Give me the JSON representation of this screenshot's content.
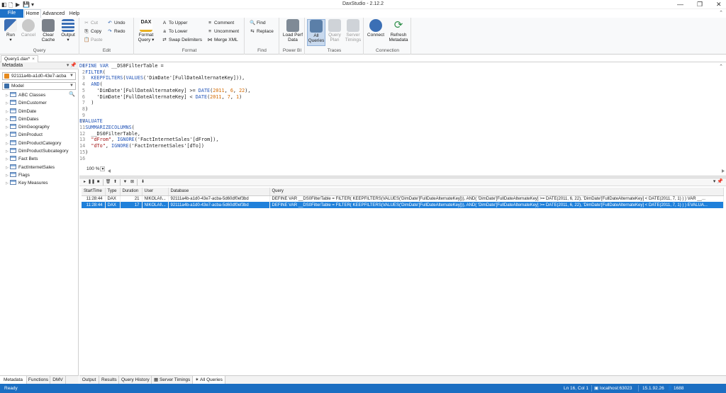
{
  "window": {
    "title": "DaxStudio - 2.12.2"
  },
  "menu": {
    "file": "File",
    "tabs": [
      "Home",
      "Advanced",
      "Help"
    ]
  },
  "ribbon": {
    "query": {
      "label": "Query",
      "run": "Run",
      "cancel": "Cancel",
      "clear_cache": "Clear Cache",
      "output": "Output"
    },
    "edit": {
      "label": "Edit",
      "cut": "Cut",
      "copy": "Copy",
      "paste": "Paste",
      "undo": "Undo",
      "redo": "Redo"
    },
    "format": {
      "label": "Format",
      "format_query": "Format Query",
      "to_upper": "To Upper",
      "to_lower": "To Lower",
      "swap_delimiters": "Swap Delimiters",
      "comment": "Comment",
      "uncomment": "Uncomment",
      "merge_xml": "Merge XML",
      "dax_logo": "DAX"
    },
    "find": {
      "label": "Find",
      "find": "Find",
      "replace": "Replace"
    },
    "powerbi": {
      "label": "Power BI",
      "load_perf_data": "Load Perf Data"
    },
    "traces": {
      "label": "Traces",
      "all_queries": "All Queries",
      "query_plan": "Query Plan",
      "server_timings": "Server Timings"
    },
    "connection": {
      "label": "Connection",
      "connect": "Connect",
      "refresh_metadata": "Refresh Metadata"
    }
  },
  "document_tab": {
    "title": "Query1.dax*",
    "close": "×"
  },
  "metadata": {
    "header": "Metadata",
    "pin": "▾ 📌",
    "database": "92111a4b-a1d0-43e7-acba",
    "model": "Model",
    "tables": [
      "ABC Classes",
      "DimCustomer",
      "DimDate",
      "DimDates",
      "DimGeography",
      "DimProduct",
      "DimProductCategory",
      "DimProductSubcategory",
      "Fact Bets",
      "FactInternetSales",
      "Flags",
      "Key Measures"
    ],
    "tabs": [
      "Metadata",
      "Functions",
      "DMV"
    ]
  },
  "editor": {
    "line_numbers": [
      "1",
      "2",
      "3",
      "4",
      "5",
      "6",
      "7",
      "8",
      "9",
      "10",
      "11",
      "12",
      "13",
      "14",
      "15",
      "16"
    ],
    "zoom": "100 %"
  },
  "results": {
    "columns": [
      "StartTime",
      "Type",
      "Duration",
      "User",
      "Database",
      "Query"
    ],
    "rows": [
      {
        "start": "11:28:44",
        "type": "DAX",
        "duration": "21",
        "user": "NIKOLAI\\...",
        "database": "92111a4b-a1d0-43e7-acba-5d60df0ef3bd",
        "query": "DEFINE VAR __DS0FilterTable = FILTER( KEEPFILTERS(VALUES('DimDate'[FullDateAlternateKey])), AND( 'DimDate'[FullDateAlternateKey] >= DATE(2011, 6, 22), 'DimDate'[FullDateAlternateKey] < DATE(2011, 7, 1) ) ) VAR __..."
      },
      {
        "start": "11:28:44",
        "type": "DAX",
        "duration": "17",
        "user": "NIKOLAI\\...",
        "database": "92111a4b-a1d0-43e7-acba-5d60df0ef3bd",
        "query": "DEFINE VAR __DS0FilterTable = FILTER( KEEPFILTERS(VALUES('DimDate'[FullDateAlternateKey])), AND( 'DimDate'[FullDateAlternateKey] >= DATE(2011, 6, 22), 'DimDate'[FullDateAlternateKey] < DATE(2011, 7, 1) ) ) EVALUA..."
      }
    ],
    "tabs": [
      "Output",
      "Results",
      "Query History",
      "Server Timings",
      "All Queries"
    ]
  },
  "status": {
    "state": "Ready",
    "position": "Ln 16, Col 1",
    "server": "localhost:63023",
    "version": "15.1.92.26",
    "spid": "1688"
  },
  "colors": {
    "accent": "#1b6ec2",
    "selection": "#1f80da"
  }
}
